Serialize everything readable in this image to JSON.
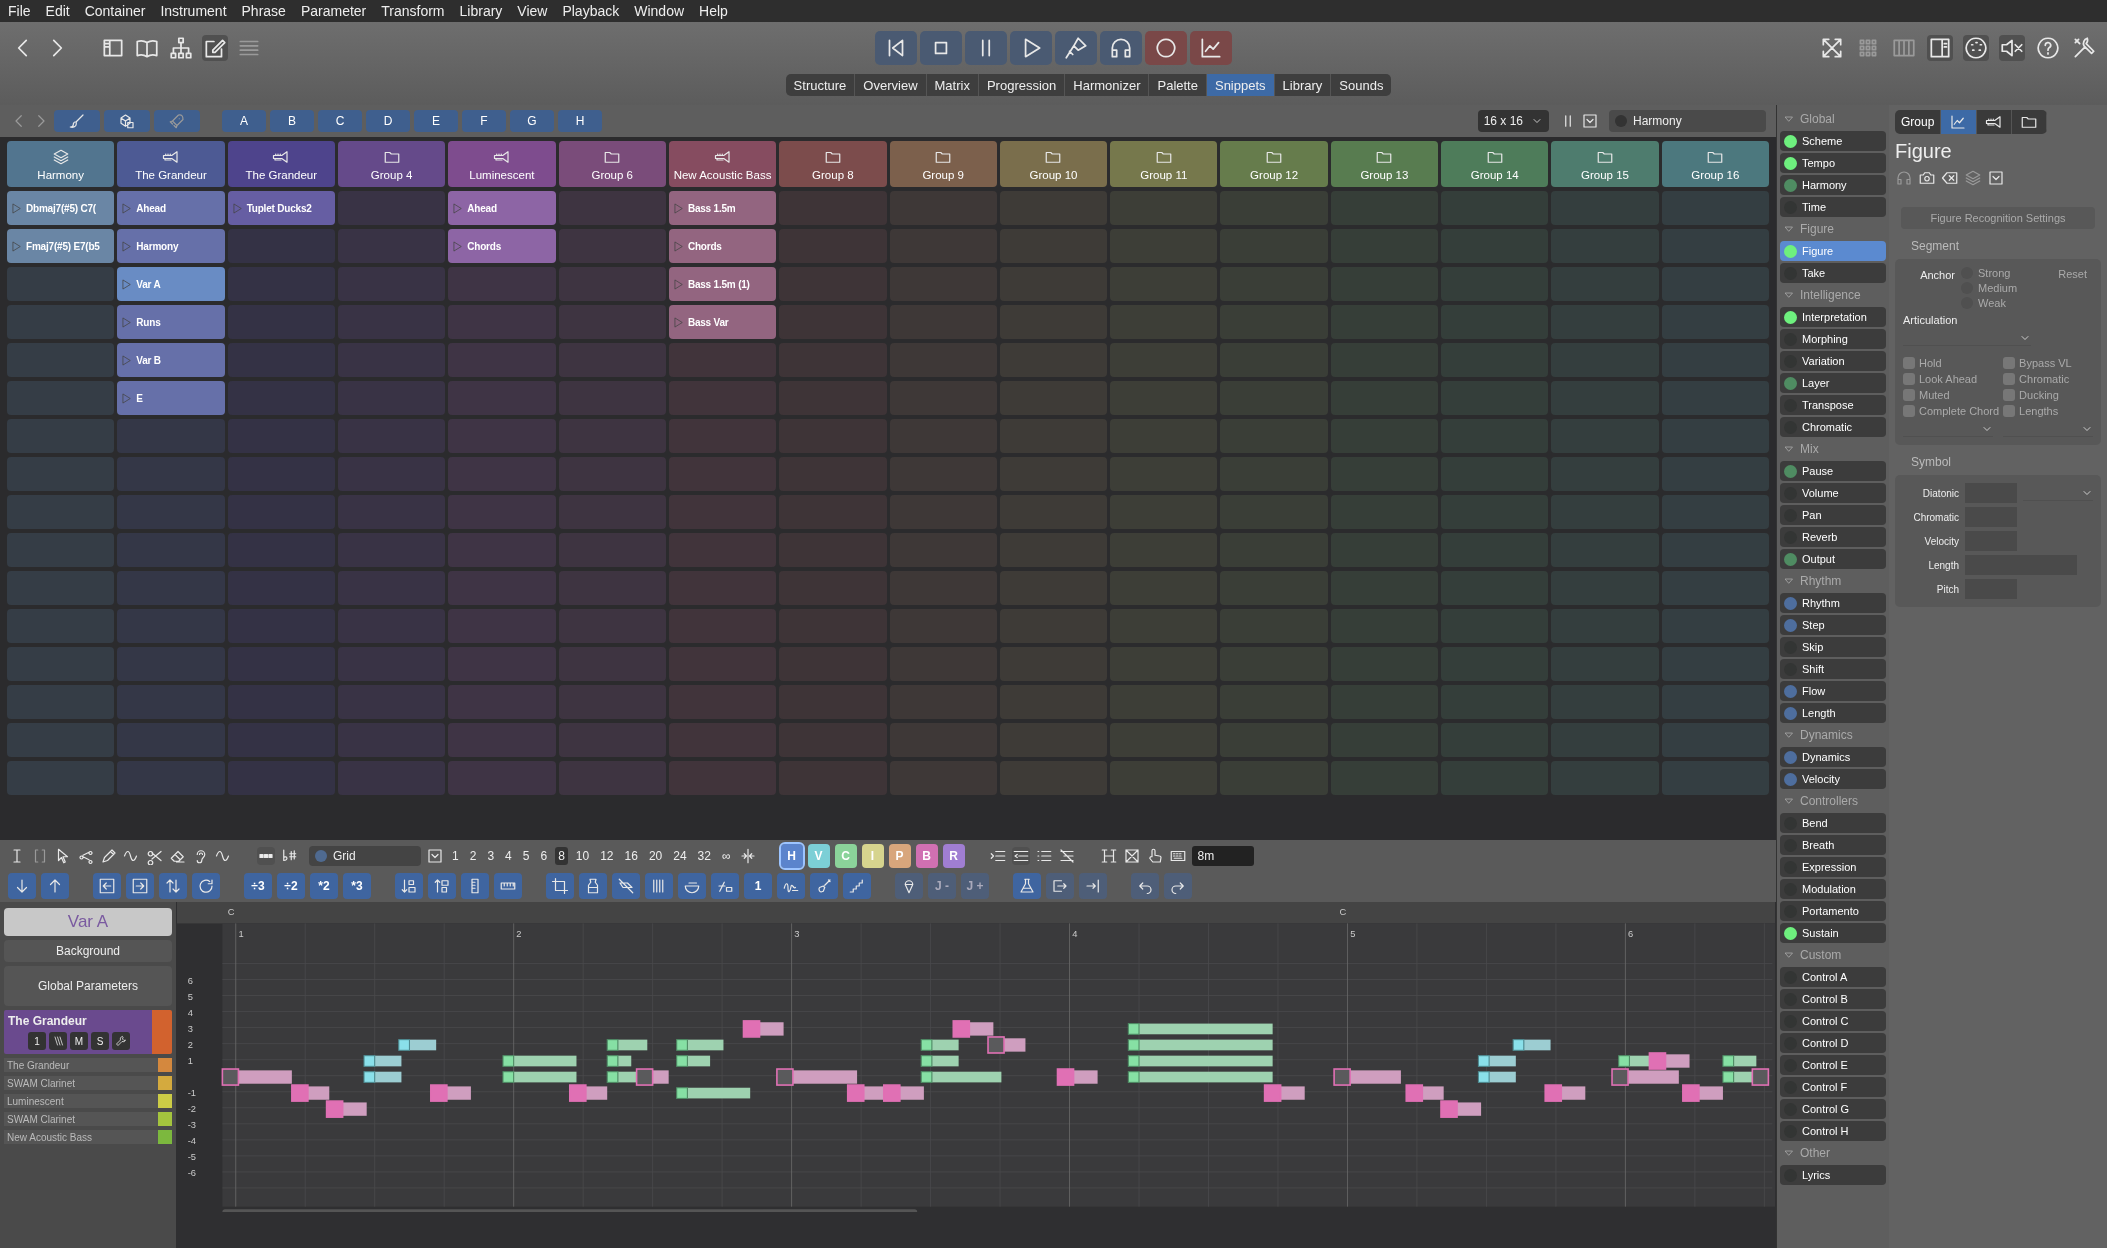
{
  "menu": [
    "File",
    "Edit",
    "Container",
    "Instrument",
    "Phrase",
    "Parameter",
    "Transform",
    "Library",
    "View",
    "Playback",
    "Window",
    "Help"
  ],
  "view_tabs": [
    {
      "label": "Structure",
      "selected": false
    },
    {
      "label": "Overview",
      "selected": false
    },
    {
      "label": "Matrix",
      "selected": false
    },
    {
      "label": "Progression",
      "selected": false
    },
    {
      "label": "Harmonizer",
      "selected": false
    },
    {
      "label": "Palette",
      "selected": false
    },
    {
      "label": "Snippets",
      "selected": true
    },
    {
      "label": "Library",
      "selected": false
    },
    {
      "label": "Sounds",
      "selected": false
    }
  ],
  "snippets": {
    "sections": [
      "A",
      "B",
      "C",
      "D",
      "E",
      "F",
      "G",
      "H"
    ],
    "grid_size": "16 x 16",
    "harmony_field": "Harmony",
    "groups": [
      {
        "name": "Harmony",
        "kind": "layers",
        "color": "#52758f",
        "clips": [
          {
            "label": "Dbmaj7(#5) C7(",
            "selected": false
          },
          {
            "label": "Fmaj7(#5) E7(b5",
            "selected": false
          }
        ]
      },
      {
        "name": "The Grandeur",
        "kind": "trumpet",
        "color": "#4d5a94",
        "clips": [
          {
            "label": "Ahead",
            "selected": false
          },
          {
            "label": "Harmony",
            "selected": false
          },
          {
            "label": "Var A",
            "selected": true
          },
          {
            "label": "Runs",
            "selected": false
          },
          {
            "label": "Var B",
            "selected": false
          },
          {
            "label": "E",
            "selected": false
          }
        ]
      },
      {
        "name": "The Grandeur",
        "kind": "trumpet",
        "color": "#4e448c",
        "clips": [
          {
            "label": "Tuplet Ducks2",
            "selected": false
          }
        ]
      },
      {
        "name": "Group 4",
        "kind": "folder",
        "color": "#654a8a"
      },
      {
        "name": "Luminescent",
        "kind": "trumpet",
        "color": "#7e4c8e",
        "clips": [
          {
            "label": "Ahead",
            "selected": false
          },
          {
            "label": "Chords",
            "selected": false
          }
        ]
      },
      {
        "name": "Group 6",
        "kind": "folder",
        "color": "#7a4c7a"
      },
      {
        "name": "New Acoustic Bass",
        "kind": "trumpet",
        "color": "#864c60",
        "clips": [
          {
            "label": "Bass 1.5m",
            "selected": false
          },
          {
            "label": "Chords",
            "selected": false
          },
          {
            "label": "Bass 1.5m (1)",
            "selected": false
          },
          {
            "label": "Bass Var",
            "selected": false
          }
        ]
      },
      {
        "name": "Group 8",
        "kind": "folder",
        "color": "#7c4c4c"
      },
      {
        "name": "Group 9",
        "kind": "folder",
        "color": "#7c604c"
      },
      {
        "name": "Group 10",
        "kind": "folder",
        "color": "#7a6e4c"
      },
      {
        "name": "Group 11",
        "kind": "folder",
        "color": "#76784c"
      },
      {
        "name": "Group 12",
        "kind": "folder",
        "color": "#667c4c"
      },
      {
        "name": "Group 13",
        "kind": "folder",
        "color": "#587c50"
      },
      {
        "name": "Group 14",
        "kind": "folder",
        "color": "#4e7c5a"
      },
      {
        "name": "Group 15",
        "kind": "folder",
        "color": "#4e7c6e"
      },
      {
        "name": "Group 16",
        "kind": "folder",
        "color": "#4c787e"
      }
    ]
  },
  "sidebar": [
    {
      "title": "Global",
      "items": [
        {
          "label": "Scheme",
          "color": "#6ef07e",
          "selected": false
        },
        {
          "label": "Tempo",
          "color": "#6ef07e",
          "selected": false
        },
        {
          "label": "Harmony",
          "color": "#4f8c62",
          "selected": false
        },
        {
          "label": "Time",
          "color": "#333534",
          "selected": false
        }
      ]
    },
    {
      "title": "Figure",
      "items": [
        {
          "label": "Figure",
          "color": "#6ef07e",
          "selected": true
        },
        {
          "label": "Take",
          "color": "#333534",
          "selected": false
        }
      ]
    },
    {
      "title": "Intelligence",
      "items": [
        {
          "label": "Interpretation",
          "color": "#6ef07e",
          "selected": false
        },
        {
          "label": "Morphing",
          "color": "#333534",
          "selected": false
        },
        {
          "label": "Variation",
          "color": "#333534",
          "selected": false
        },
        {
          "label": "Layer",
          "color": "#4f8c62",
          "selected": false
        },
        {
          "label": "Transpose",
          "color": "#333534",
          "selected": false
        },
        {
          "label": "Chromatic",
          "color": "#333534",
          "selected": false
        }
      ]
    },
    {
      "title": "Mix",
      "items": [
        {
          "label": "Pause",
          "color": "#4f8c62",
          "selected": false
        },
        {
          "label": "Volume",
          "color": "#333534",
          "selected": false
        },
        {
          "label": "Pan",
          "color": "#333534",
          "selected": false
        },
        {
          "label": "Reverb",
          "color": "#333534",
          "selected": false
        },
        {
          "label": "Output",
          "color": "#4f8c62",
          "selected": false
        }
      ]
    },
    {
      "title": "Rhythm",
      "items": [
        {
          "label": "Rhythm",
          "color": "#4e6e9e",
          "selected": false
        },
        {
          "label": "Step",
          "color": "#4e6e9e",
          "selected": false
        },
        {
          "label": "Skip",
          "color": "#333534",
          "selected": false
        },
        {
          "label": "Shift",
          "color": "#333534",
          "selected": false
        },
        {
          "label": "Flow",
          "color": "#4e6e9e",
          "selected": false
        },
        {
          "label": "Length",
          "color": "#4e6e9e",
          "selected": false
        }
      ]
    },
    {
      "title": "Dynamics",
      "items": [
        {
          "label": "Dynamics",
          "color": "#4e6e9e",
          "selected": false
        },
        {
          "label": "Velocity",
          "color": "#4e6e9e",
          "selected": false
        }
      ]
    },
    {
      "title": "Controllers",
      "items": [
        {
          "label": "Bend",
          "color": "#333534",
          "selected": false
        },
        {
          "label": "Breath",
          "color": "#333534",
          "selected": false
        },
        {
          "label": "Expression",
          "color": "#333534",
          "selected": false
        },
        {
          "label": "Modulation",
          "color": "#333534",
          "selected": false
        },
        {
          "label": "Portamento",
          "color": "#333534",
          "selected": false
        },
        {
          "label": "Sustain",
          "color": "#6ef07e",
          "selected": false
        }
      ]
    },
    {
      "title": "Custom",
      "items": [
        {
          "label": "Control A",
          "color": "#333534",
          "selected": false
        },
        {
          "label": "Control B",
          "color": "#333534",
          "selected": false
        },
        {
          "label": "Control C",
          "color": "#333534",
          "selected": false
        },
        {
          "label": "Control D",
          "color": "#333534",
          "selected": false
        },
        {
          "label": "Control E",
          "color": "#333534",
          "selected": false
        },
        {
          "label": "Control F",
          "color": "#333534",
          "selected": false
        },
        {
          "label": "Control G",
          "color": "#333534",
          "selected": false
        },
        {
          "label": "Control H",
          "color": "#333534",
          "selected": false
        }
      ]
    },
    {
      "title": "Other",
      "items": [
        {
          "label": "Lyrics",
          "color": "#333534",
          "selected": false
        }
      ]
    }
  ],
  "inspector": {
    "tabs": [
      {
        "kind": "text",
        "label": "Group",
        "selected": false
      },
      {
        "kind": "chart",
        "selected": true
      },
      {
        "kind": "trumpet",
        "selected": false
      },
      {
        "kind": "folder",
        "selected": false
      }
    ],
    "title": "Figure",
    "recognition_button": "Figure Recognition Settings",
    "segment": {
      "title": "Segment",
      "anchor_label": "Anchor",
      "anchor_options": [
        {
          "label": "Strong",
          "selected": false
        },
        {
          "label": "Medium",
          "selected": false
        },
        {
          "label": "Weak",
          "selected": false
        }
      ],
      "reset": "Reset",
      "articulation_label": "Articulation",
      "checkboxes": [
        {
          "label": "Hold",
          "checked": false
        },
        {
          "label": "Bypass VL",
          "checked": false
        },
        {
          "label": "Look Ahead",
          "checked": false
        },
        {
          "label": "Chromatic",
          "checked": false
        },
        {
          "label": "Muted",
          "checked": false
        },
        {
          "label": "Ducking",
          "checked": false
        },
        {
          "label": "Complete Chord",
          "checked": false
        },
        {
          "label": "Lengths",
          "checked": false
        }
      ]
    },
    "symbol": {
      "title": "Symbol",
      "fields": [
        {
          "label": "Diatonic",
          "kind": "dropdown"
        },
        {
          "label": "Chromatic",
          "kind": "short"
        },
        {
          "label": "Velocity",
          "kind": "short"
        },
        {
          "label": "Length",
          "kind": "long"
        },
        {
          "label": "Pitch",
          "kind": "short"
        }
      ]
    }
  },
  "editor": {
    "grid_select": "Grid",
    "grid_values": [
      {
        "label": "1",
        "selected": false
      },
      {
        "label": "2",
        "selected": false
      },
      {
        "label": "3",
        "selected": false
      },
      {
        "label": "4",
        "selected": false
      },
      {
        "label": "5",
        "selected": false
      },
      {
        "label": "6",
        "selected": false
      },
      {
        "label": "8",
        "selected": true
      },
      {
        "label": "10",
        "selected": false
      },
      {
        "label": "12",
        "selected": false
      },
      {
        "label": "16",
        "selected": false
      },
      {
        "label": "20",
        "selected": false
      },
      {
        "label": "24",
        "selected": false
      },
      {
        "label": "32",
        "selected": false
      },
      {
        "label": "∞",
        "selected": false
      }
    ],
    "voice_buttons": [
      {
        "label": "H",
        "color": "#5b84cc",
        "selected": true
      },
      {
        "label": "V",
        "color": "#7ccfd6",
        "selected": false
      },
      {
        "label": "C",
        "color": "#8bd39a",
        "selected": false
      },
      {
        "label": "I",
        "color": "#d6d48e",
        "selected": false
      },
      {
        "label": "P",
        "color": "#d8a67c",
        "selected": false
      },
      {
        "label": "B",
        "color": "#d070b2",
        "selected": false
      },
      {
        "label": "R",
        "color": "#a07ed2",
        "selected": false
      }
    ],
    "length_field": "8m",
    "step_buttons": [
      "÷3",
      "÷2",
      "*2",
      "*3"
    ],
    "voice_number": "1",
    "jump_buttons": [
      {
        "label": "J -",
        "disabled": true
      },
      {
        "label": "J +",
        "disabled": true
      }
    ],
    "snippet_title": "Var A",
    "background_select": "Background",
    "global_button": "Global Parameters",
    "track": {
      "name": "The Grandeur",
      "color": "#d2622e",
      "buttons": [
        "1",
        "M",
        "S"
      ]
    },
    "tracks": [
      {
        "name": "The Grandeur",
        "color": "#d4883e"
      },
      {
        "name": "SWAM Clarinet",
        "color": "#d4aa3e"
      },
      {
        "name": "Luminescent",
        "color": "#cccc46"
      },
      {
        "name": "SWAM Clarinet",
        "color": "#a4c43e"
      },
      {
        "name": "New Acoustic Bass",
        "color": "#7cb83e"
      }
    ],
    "bars": [
      {
        "number": "1",
        "chord": "C"
      },
      {
        "number": "2"
      },
      {
        "number": "3"
      },
      {
        "number": "4"
      },
      {
        "number": "5",
        "chord": "C"
      },
      {
        "number": "6"
      }
    ],
    "pitch_labels": [
      "6",
      "5",
      "4",
      "3",
      "2",
      "1",
      "-1",
      "-2",
      "-3",
      "-4",
      "-5",
      "-6"
    ]
  }
}
